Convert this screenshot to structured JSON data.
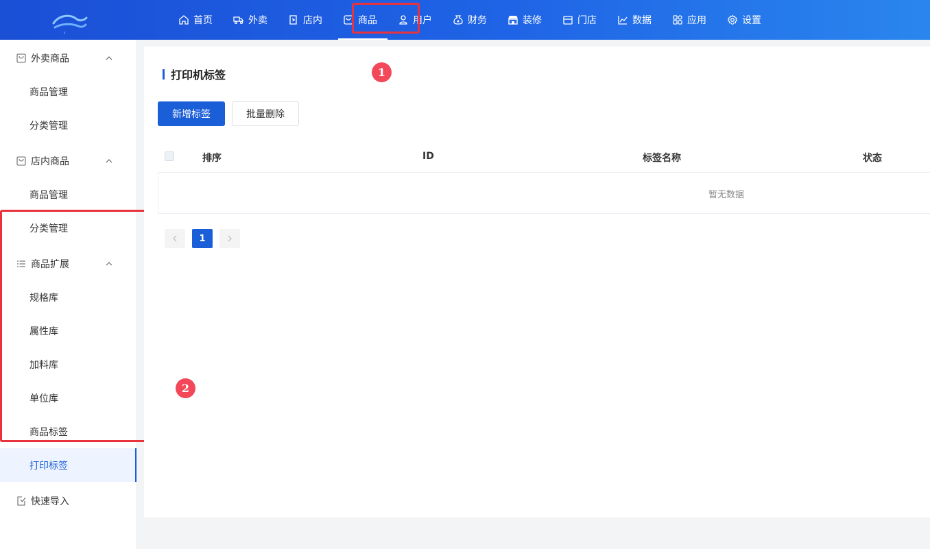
{
  "nav": {
    "items": [
      {
        "label": "首页",
        "icon": "home-icon"
      },
      {
        "label": "外卖",
        "icon": "delivery-icon"
      },
      {
        "label": "店内",
        "icon": "store-in-icon"
      },
      {
        "label": "商品",
        "icon": "bag-icon"
      },
      {
        "label": "用户",
        "icon": "user-icon"
      },
      {
        "label": "财务",
        "icon": "money-bag-icon"
      },
      {
        "label": "装修",
        "icon": "shop-decor-icon"
      },
      {
        "label": "门店",
        "icon": "shop-icon"
      },
      {
        "label": "数据",
        "icon": "chart-icon"
      },
      {
        "label": "应用",
        "icon": "apps-icon"
      },
      {
        "label": "设置",
        "icon": "gear-icon"
      }
    ],
    "active": "商品"
  },
  "sidebar": {
    "groups": [
      {
        "label": "外卖商品",
        "icon": "bag-icon",
        "items": [
          "商品管理",
          "分类管理"
        ]
      },
      {
        "label": "店内商品",
        "icon": "bag-icon",
        "items": [
          "商品管理",
          "分类管理"
        ]
      },
      {
        "label": "商品扩展",
        "icon": "list-icon",
        "items": [
          "规格库",
          "属性库",
          "加料库",
          "单位库",
          "商品标签",
          "打印标签"
        ]
      },
      {
        "label": "快速导入",
        "icon": "import-icon",
        "items": []
      }
    ],
    "active_item": "打印标签"
  },
  "main": {
    "title": "打印机标签",
    "buttons": {
      "add": "新增标签",
      "batch_delete": "批量删除"
    },
    "table": {
      "columns": [
        "排序",
        "ID",
        "标签名称",
        "状态"
      ],
      "empty_text": "暂无数据"
    },
    "pagination": {
      "current": "1"
    }
  },
  "annotations": {
    "badge1": "1",
    "badge2": "2"
  },
  "colors": {
    "primary": "#1a5ed8",
    "highlight": "#e8323c",
    "badge": "#f2485a"
  }
}
